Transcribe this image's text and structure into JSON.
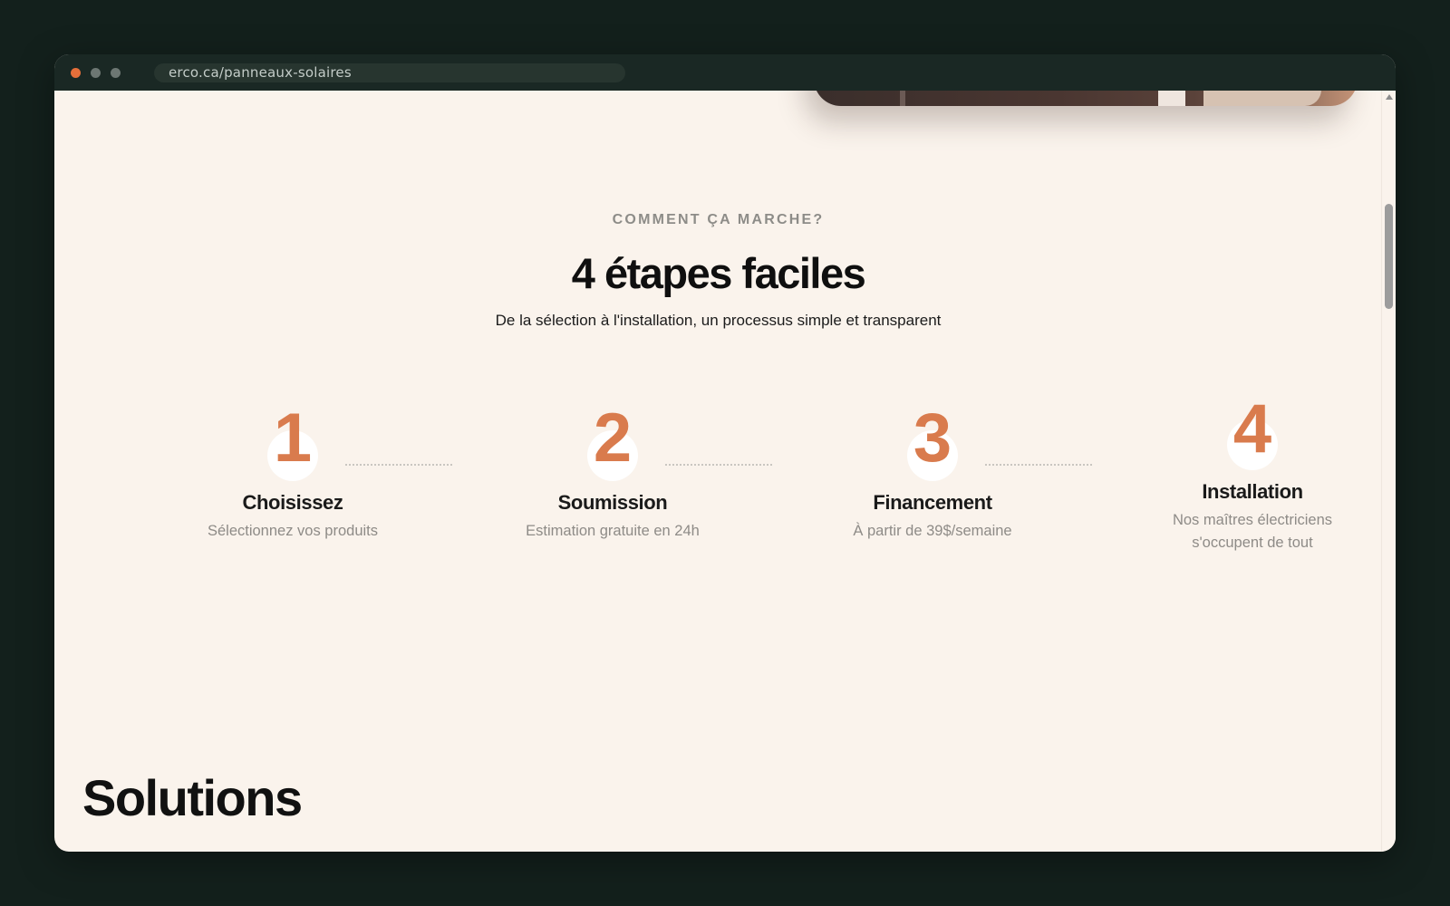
{
  "browser": {
    "url": "erco.ca/panneaux-solaires"
  },
  "section": {
    "eyebrow": "COMMENT ÇA MARCHE?",
    "title": "4 étapes faciles",
    "subtitle": "De la sélection à l'installation, un processus simple et transparent"
  },
  "steps": [
    {
      "number": "1",
      "title": "Choisissez",
      "description": "Sélectionnez vos produits"
    },
    {
      "number": "2",
      "title": "Soumission",
      "description": "Estimation gratuite en 24h"
    },
    {
      "number": "3",
      "title": "Financement",
      "description": "À partir de 39$/semaine"
    },
    {
      "number": "4",
      "title": "Installation",
      "description_line1": "Nos maîtres électriciens",
      "description_line2": "s'occupent de tout"
    }
  ],
  "next_section": {
    "title": "Solutions"
  },
  "colors": {
    "accent": "#d97b4d",
    "page_background": "#faf3ec",
    "frame": "#13201c",
    "titlebar": "#1a2824"
  }
}
